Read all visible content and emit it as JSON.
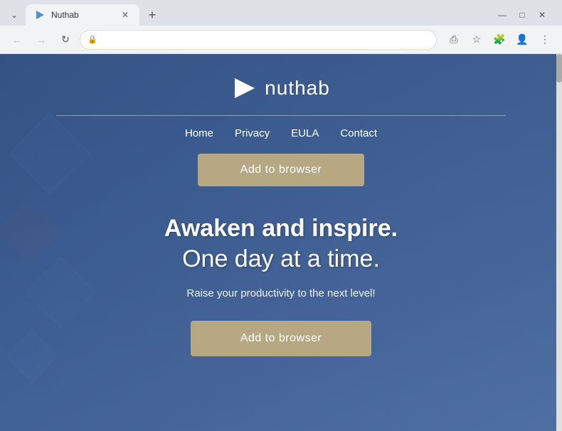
{
  "browser": {
    "tab": {
      "title": "Nuthab",
      "favicon": "▶"
    },
    "window_controls": {
      "minimize": "—",
      "maximize": "□",
      "close": "✕",
      "tab_list": "⌄"
    },
    "nav": {
      "back": "←",
      "forward": "→",
      "refresh": "↻"
    },
    "url": {
      "lock": "🔒",
      "text": ""
    },
    "toolbar": {
      "share": "⎙",
      "bookmark": "☆",
      "extensions": "🧩",
      "profile": "👤",
      "menu": "⋮"
    }
  },
  "page": {
    "logo": {
      "icon_label": "nuthab-play-icon",
      "text": "nuthab"
    },
    "nav_links": [
      {
        "label": "Home"
      },
      {
        "label": "Privacy"
      },
      {
        "label": "EULA"
      },
      {
        "label": "Contact"
      }
    ],
    "add_to_browser_top": "Add to browser",
    "hero": {
      "headline_bold": "Awaken and inspire.",
      "headline_normal": "One day at a time.",
      "tagline": "Raise your productivity to the next level!",
      "add_to_browser_bottom": "Add to browser"
    }
  }
}
